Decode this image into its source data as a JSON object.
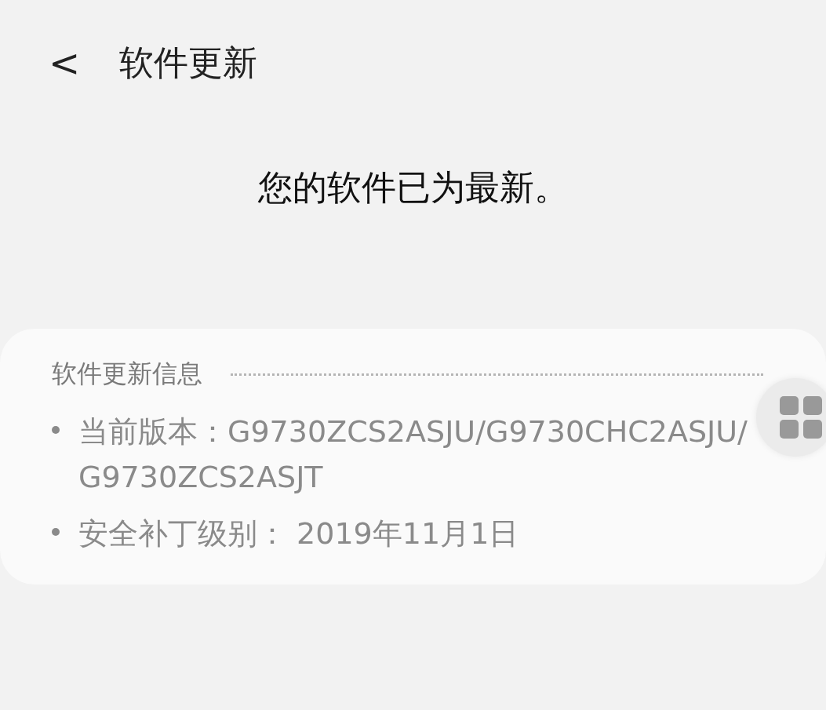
{
  "header": {
    "back": "<",
    "title": "软件更新"
  },
  "status_message": "您的软件已为最新。",
  "info_card": {
    "title": "软件更新信息",
    "items": [
      {
        "text": "当前版本：G9730ZCS2ASJU/G9730CHC2ASJU/G9730ZCS2ASJT"
      },
      {
        "text": "安全补丁级别： 2019年11月1日"
      }
    ]
  }
}
